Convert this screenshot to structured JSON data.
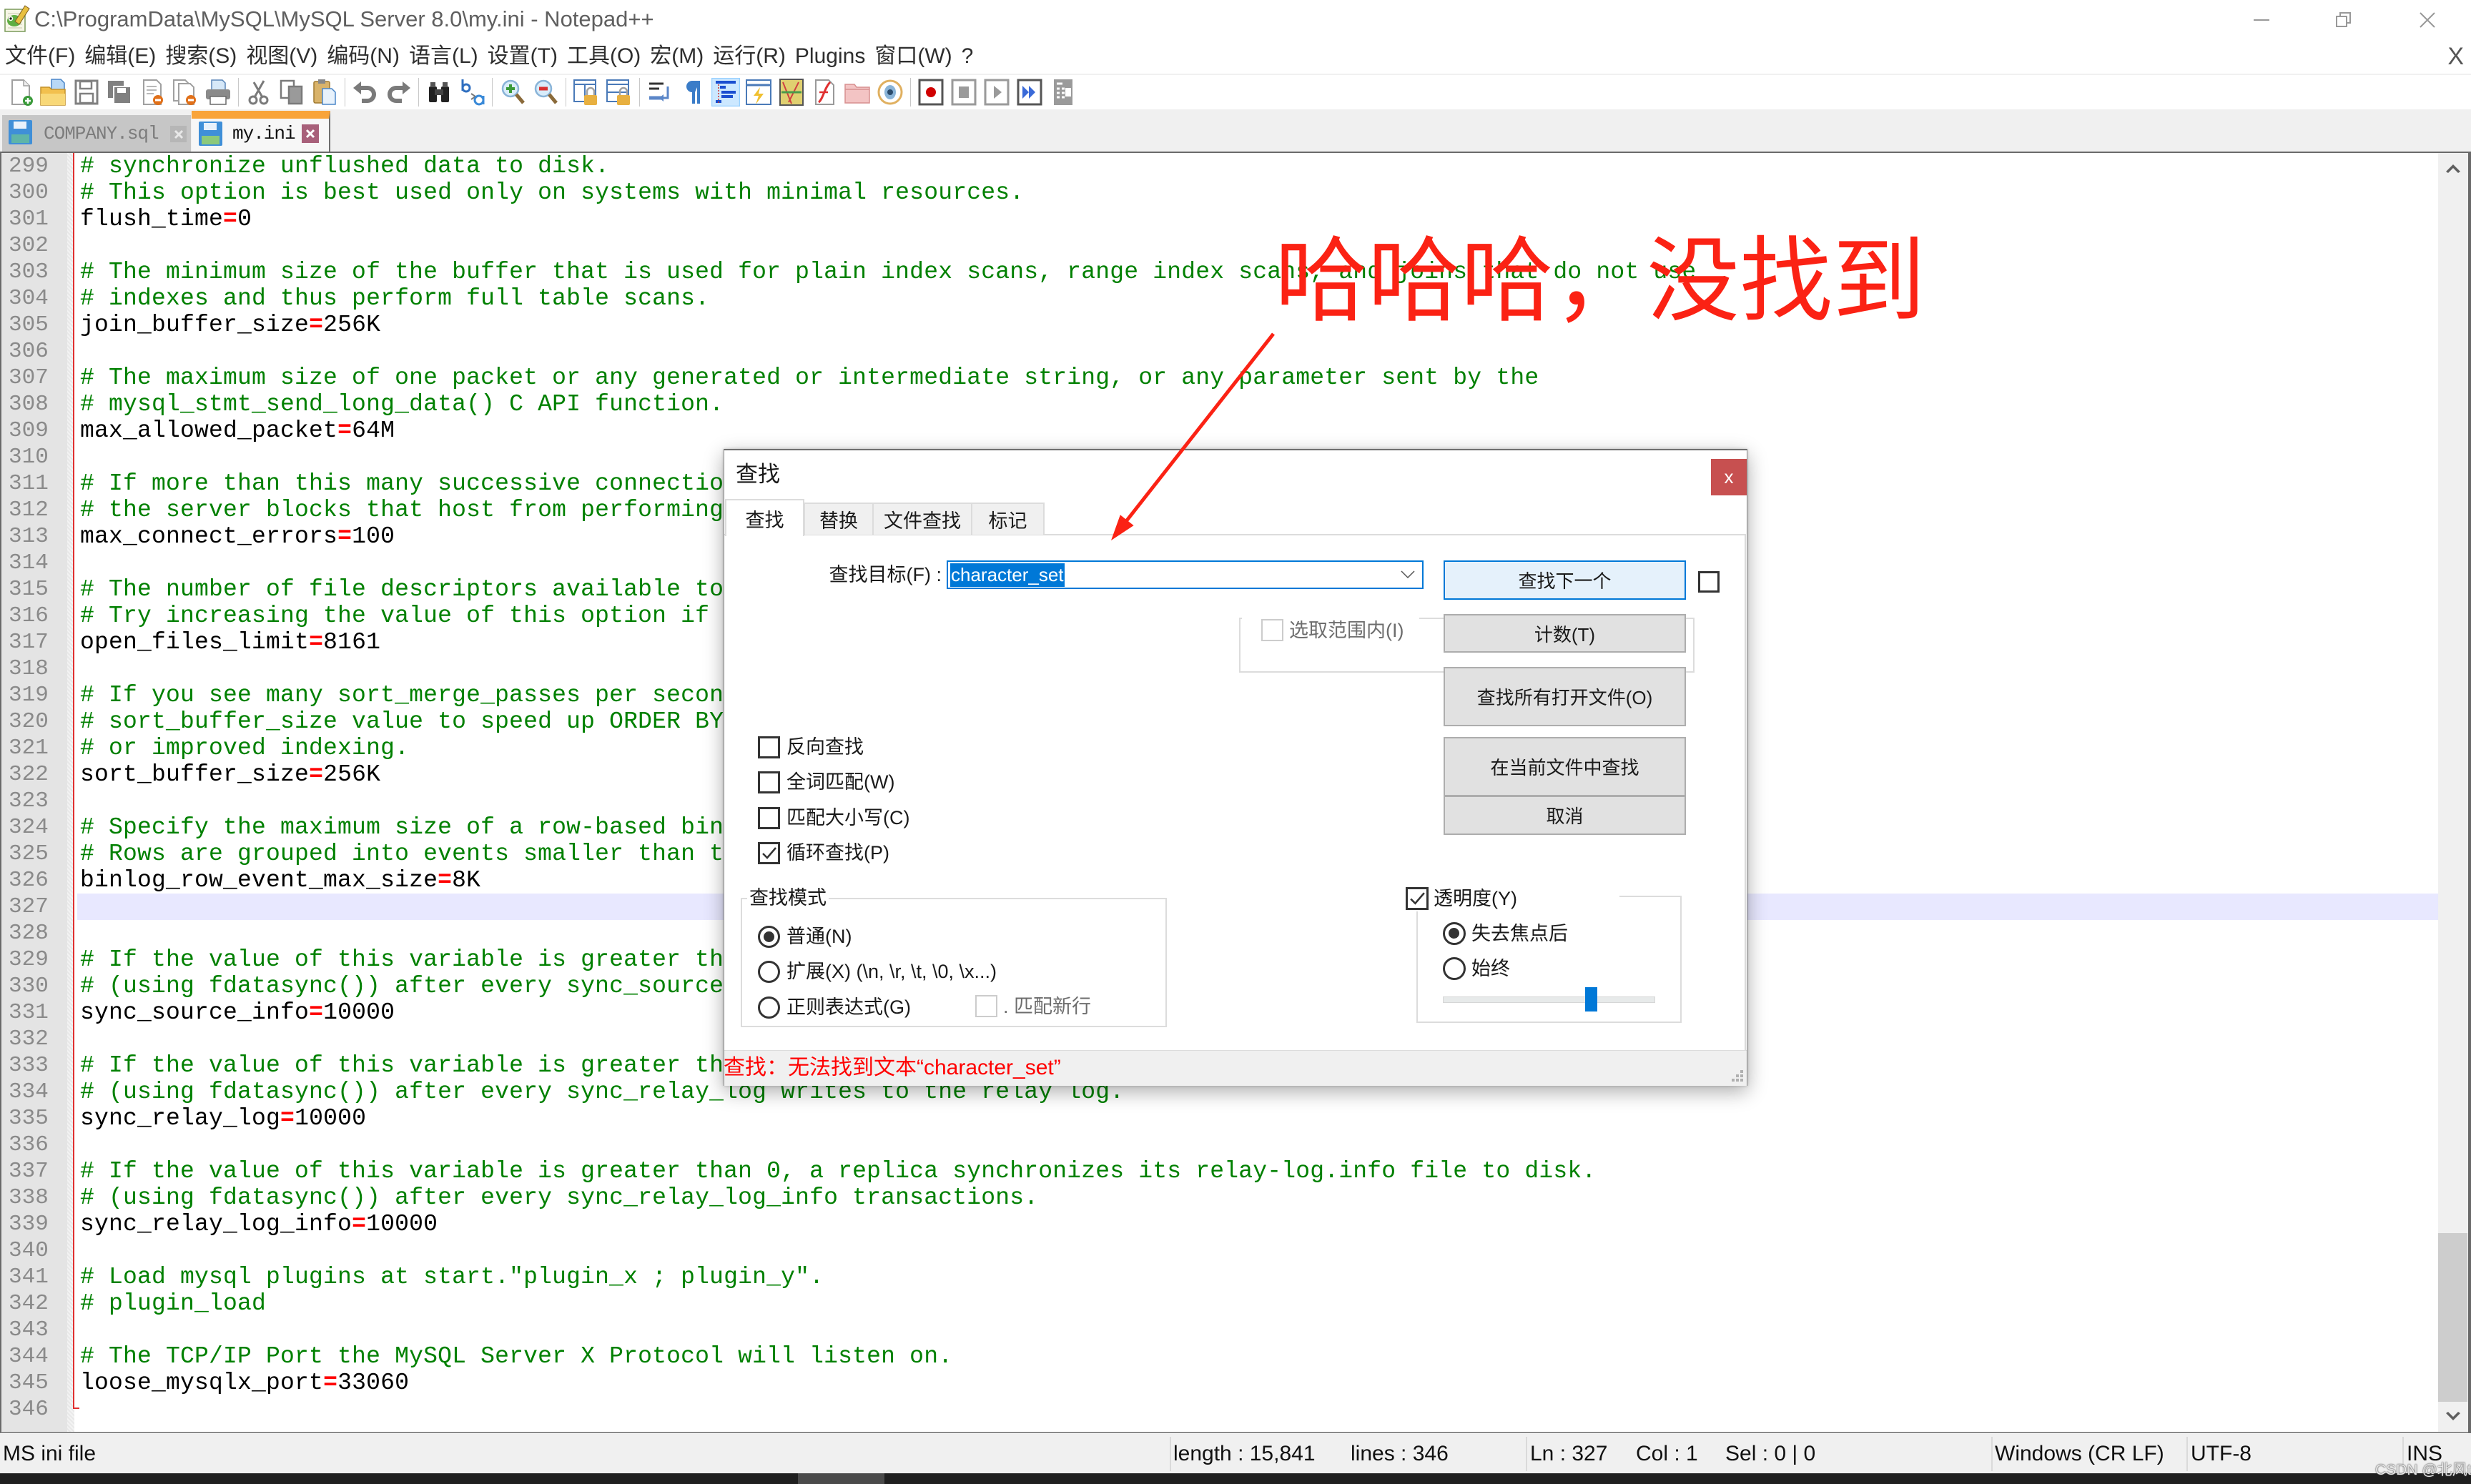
{
  "window": {
    "title": "C:\\ProgramData\\MySQL\\MySQL Server 8.0\\my.ini - Notepad++",
    "app_icon": "notepad-plus-plus-icon",
    "controls": [
      "minimize-icon",
      "restore-icon",
      "close-icon"
    ]
  },
  "menu": {
    "items": [
      "文件(F)",
      "编辑(E)",
      "搜索(S)",
      "视图(V)",
      "编码(N)",
      "语言(L)",
      "设置(T)",
      "工具(O)",
      "宏(M)",
      "运行(R)",
      "Plugins",
      "窗口(W)",
      "?"
    ],
    "close_document": "X"
  },
  "toolbar": {
    "groups": [
      [
        "new-file-icon",
        "open-file-icon",
        "save-icon",
        "save-all-icon",
        "close-icon",
        "close-all-icon",
        "print-icon"
      ],
      [
        "cut-icon",
        "copy-icon",
        "paste-icon"
      ],
      [
        "undo-icon",
        "redo-icon"
      ],
      [
        "find-icon",
        "replace-icon"
      ],
      [
        "zoom-in-icon",
        "zoom-out-icon"
      ],
      [
        "sync-vertical-scroll-icon",
        "sync-horizontal-scroll-icon"
      ],
      [
        "word-wrap-icon",
        "show-all-characters-icon"
      ],
      [
        "indent-guide-icon",
        "user-defined-language-icon",
        "document-map-icon",
        "function-list-icon",
        "folder-as-workspace-icon",
        "document-monitoring-icon"
      ],
      [
        "start-recording-icon",
        "stop-recording-icon",
        "playback-icon",
        "run-macro-multiple-icon",
        "save-macro-icon"
      ]
    ],
    "active": "indent-guide-icon"
  },
  "tabs": [
    {
      "label": "COMPANY.sql",
      "active": false,
      "icon": "saved-file-icon"
    },
    {
      "label": "my.ini",
      "active": true,
      "icon": "saved-file-icon"
    }
  ],
  "editor": {
    "current_line": 327,
    "vertical_scroll_fraction": 1.0,
    "lines": [
      {
        "n": 299,
        "text": "# synchronize unflushed data to disk."
      },
      {
        "n": 300,
        "text": "# This option is best used only on systems with minimal resources."
      },
      {
        "n": 301,
        "text": "flush_time=0"
      },
      {
        "n": 302,
        "text": ""
      },
      {
        "n": 303,
        "text": "# The minimum size of the buffer that is used for plain index scans, range index scans, and joins that do not use"
      },
      {
        "n": 304,
        "text": "# indexes and thus perform full table scans."
      },
      {
        "n": 305,
        "text": "join_buffer_size=256K"
      },
      {
        "n": 306,
        "text": ""
      },
      {
        "n": 307,
        "text": "# The maximum size of one packet or any generated or intermediate string, or any parameter sent by the"
      },
      {
        "n": 308,
        "text": "# mysql_stmt_send_long_data() C API function."
      },
      {
        "n": 309,
        "text": "max_allowed_packet=64M"
      },
      {
        "n": 310,
        "text": ""
      },
      {
        "n": 311,
        "text": "# If more than this many successive connectio"
      },
      {
        "n": 312,
        "text": "# the server blocks that host from performing"
      },
      {
        "n": 313,
        "text": "max_connect_errors=100"
      },
      {
        "n": 314,
        "text": ""
      },
      {
        "n": 315,
        "text": "# The number of file descriptors available to"
      },
      {
        "n": 316,
        "text": "# Try increasing the value of this option if"
      },
      {
        "n": 317,
        "text": "open_files_limit=8161"
      },
      {
        "n": 318,
        "text": ""
      },
      {
        "n": 319,
        "text": "# If you see many sort_merge_passes per secon"
      },
      {
        "n": 320,
        "text": "# sort_buffer_size value to speed up ORDER BY"
      },
      {
        "n": 321,
        "text": "# or improved indexing."
      },
      {
        "n": 322,
        "text": "sort_buffer_size=256K"
      },
      {
        "n": 323,
        "text": ""
      },
      {
        "n": 324,
        "text": "# Specify the maximum size of a row-based bin"
      },
      {
        "n": 325,
        "text": "# Rows are grouped into events smaller than t"
      },
      {
        "n": 326,
        "text": "binlog_row_event_max_size=8K"
      },
      {
        "n": 327,
        "text": ""
      },
      {
        "n": 328,
        "text": ""
      },
      {
        "n": 329,
        "text": "# If the value of this variable is greater th"
      },
      {
        "n": 330,
        "text": "# (using fdatasync()) after every sync_source"
      },
      {
        "n": 331,
        "text": "sync_source_info=10000"
      },
      {
        "n": 332,
        "text": ""
      },
      {
        "n": 333,
        "text": "# If the value of this variable is greater th"
      },
      {
        "n": 334,
        "text": "# (using fdatasync()) after every sync_relay_log writes to the relay log."
      },
      {
        "n": 335,
        "text": "sync_relay_log=10000"
      },
      {
        "n": 336,
        "text": ""
      },
      {
        "n": 337,
        "text": "# If the value of this variable is greater than 0, a replica synchronizes its relay-log.info file to disk."
      },
      {
        "n": 338,
        "text": "# (using fdatasync()) after every sync_relay_log_info transactions."
      },
      {
        "n": 339,
        "text": "sync_relay_log_info=10000"
      },
      {
        "n": 340,
        "text": ""
      },
      {
        "n": 341,
        "text": "# Load mysql plugins at start.\"plugin_x ; plugin_y\"."
      },
      {
        "n": 342,
        "text": "# plugin_load"
      },
      {
        "n": 343,
        "text": ""
      },
      {
        "n": 344,
        "text": "# The TCP/IP Port the MySQL Server X Protocol will listen on."
      },
      {
        "n": 345,
        "text": "loose_mysqlx_port=33060"
      },
      {
        "n": 346,
        "text": ""
      }
    ]
  },
  "dialog": {
    "title": "查找",
    "close_label": "x",
    "tabs": [
      {
        "label": "查找",
        "active": true
      },
      {
        "label": "替换",
        "active": false
      },
      {
        "label": "文件查找",
        "active": false
      },
      {
        "label": "标记",
        "active": false
      }
    ],
    "find_what": {
      "label": "查找目标(F) :",
      "value": "character_set"
    },
    "buttons": {
      "find_next": "查找下一个",
      "count": "计数(T)",
      "find_all_opened": "查找所有打开文件(O)",
      "find_all_current": "在当前文件中查找",
      "cancel": "取消"
    },
    "find_next_side_checkbox": {
      "checked": false
    },
    "in_selection": {
      "label": "选取范围内(I)",
      "checked": false,
      "enabled": false
    },
    "options": [
      {
        "label": "反向查找",
        "checked": false
      },
      {
        "label": "全词匹配(W)",
        "checked": false
      },
      {
        "label": "匹配大小写(C)",
        "checked": false
      },
      {
        "label": "循环查找(P)",
        "checked": true
      }
    ],
    "search_mode": {
      "title": "查找模式",
      "options": [
        {
          "label": "普通(N)",
          "selected": true
        },
        {
          "label": "扩展(X) (\\n, \\r, \\t, \\0, \\x...)",
          "selected": false
        },
        {
          "label": "正则表达式(G)",
          "selected": false
        }
      ],
      "dot_matches_newline": {
        "label": ". 匹配新行",
        "checked": false,
        "enabled": false
      }
    },
    "transparency": {
      "label": "透明度(Y)",
      "checked": true,
      "options": [
        {
          "label": "失去焦点后",
          "selected": true
        },
        {
          "label": "始终",
          "selected": false
        }
      ],
      "level": 0.7
    },
    "status_message": "查找：无法找到文本“character_set”",
    "status_color": "#ff0000"
  },
  "annotation": {
    "text": "哈哈哈，没找到",
    "color": "#fb2214"
  },
  "status_bar": {
    "file_type": "MS ini file",
    "length": "length : 15,841",
    "lines": "lines : 346",
    "ln": "Ln : 327",
    "col": "Col : 1",
    "sel": "Sel : 0 | 0",
    "eol": "Windows (CR LF)",
    "encoding": "UTF-8",
    "mode": "INS"
  },
  "watermark": "CSDN @北风toto",
  "colors": {
    "comment": "#008000",
    "operator": "#ff0000",
    "current_line": "#e8e8ff",
    "active_tab_accent": "#f9a43a",
    "dialog_close": "#c75050",
    "selection": "#0078d7"
  }
}
